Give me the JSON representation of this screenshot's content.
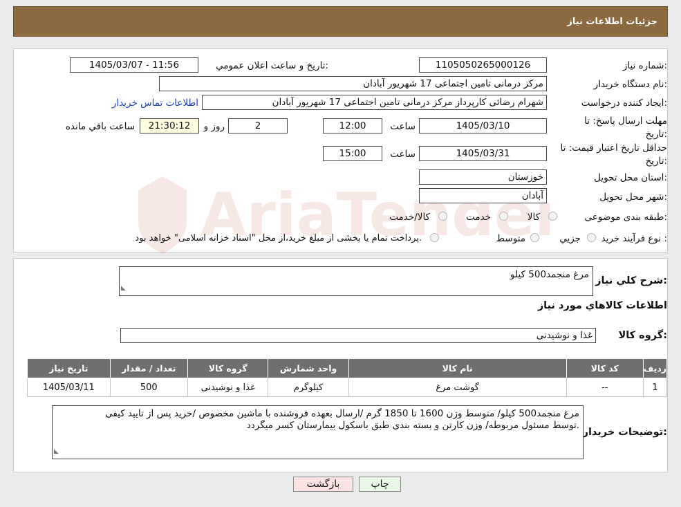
{
  "header": {
    "title": "جزئیات اطلاعات نیاز"
  },
  "form": {
    "need_no_label": "شماره نیاز:",
    "need_no": "1105050265000126",
    "announce_label": "تاریخ و ساعت اعلان عمومي:",
    "announce_value": "1405/03/07 - 11:56",
    "buyer_label": "نام دستگاه خريدار:",
    "buyer": "مرکز درمانی تامین اجتماعی 17 شهریور آبادان",
    "creator_label": "ايجاد کننده درخواست:",
    "creator": "شهرام رضائی کارپرداز مرکز درمانی تامین اجتماعی 17 شهریور آبادان",
    "contact_link": "اطلاعات تماس خريدار",
    "deadline_label": "مهلت ارسال پاسخ: تا تاریخ:",
    "deadline_date": "1405/03/10",
    "time_label": "ساعت",
    "deadline_time": "12:00",
    "days_value": "2",
    "days_label": "روز و",
    "remaining_value": "21:30:12",
    "remaining_label": "ساعت باقي مانده",
    "validity_label": "حداقل تاريخ اعتبار قيمت: تا تاريخ:",
    "validity_date": "1405/03/31",
    "validity_time": "15:00",
    "province_label": "استان محل تحويل:",
    "province": "خوزستان",
    "city_label": "شهر محل تحويل:",
    "city": "آبادان",
    "category_label": "طبقه بندی موضوعی:",
    "category_options": [
      "کالا",
      "خدمت",
      "کالا/خدمت"
    ],
    "process_label": "نوع فرآيند خريد :",
    "process_options": [
      "جزيي",
      "متوسط"
    ],
    "process_note": "پرداخت تمام یا بخشی از مبلغ خرید،از محل \"اسناد خزانه اسلامی\" خواهد بود."
  },
  "description": {
    "label": "شرح کلي نياز:",
    "value": "مرغ منجمد500 کیلو"
  },
  "goods": {
    "title": "اطلاعات کالاهاي مورد نياز",
    "group_label": "گروه کالا:",
    "group_value": "غذا و نوشیدنی",
    "columns": [
      "رديف",
      "کد کالا",
      "نام کالا",
      "واحد شمارش",
      "گروه کالا",
      "تعداد / مقدار",
      "تاريخ نياز"
    ],
    "rows": [
      [
        "1",
        "--",
        "گوشت مرغ",
        "کیلوگرم",
        "غذا و نوشیدنی",
        "500",
        "1405/03/11"
      ]
    ]
  },
  "buyer_notes": {
    "label": "توضيحات خريدار:",
    "line1": "مرغ منجمد500 کیلو/ متوسط وزن 1600 تا 1850 گرم /ارسال بعهده فروشنده با ماشین مخصوص /خرید پس از تایید کیفی",
    "line2": "توسط مسئول مربوطه/ وزن کارتن و بسته بندی طبق باسکول بیمارستان کسر میگردد."
  },
  "buttons": {
    "print": "چاپ",
    "back": "بازگشت"
  },
  "watermark": {
    "text": "AriaTender.neT"
  },
  "colors": {
    "header_bg": "#8b6a3f",
    "table_header": "#6f6f6f",
    "link": "#1a3fbf",
    "back_bg": "#fbe3e3",
    "print_bg": "#eaf7e6",
    "watermark": "#c0392b"
  }
}
